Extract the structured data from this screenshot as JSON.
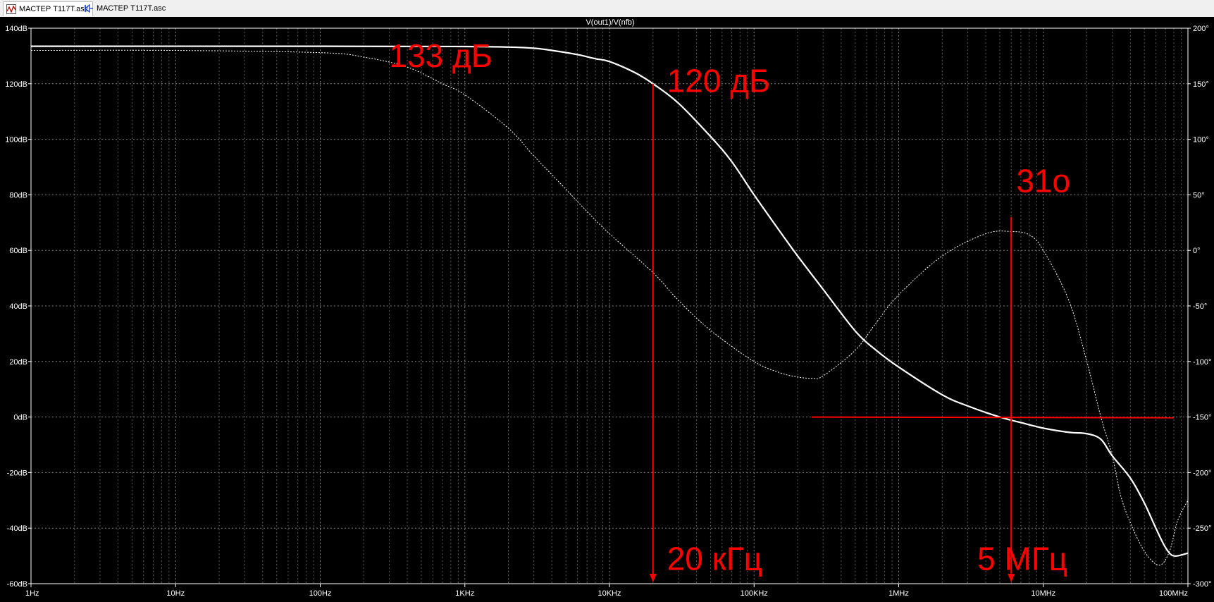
{
  "tabs": [
    {
      "label": "МАСТЕР Т117Т.asc",
      "icon": "waveform-plot-icon",
      "active": true
    },
    {
      "label": "МАСТЕР Т117Т.asc",
      "icon": "schematic-icon",
      "active": false
    }
  ],
  "chart_data": {
    "type": "line",
    "title": "V(out1)/V(nfb)",
    "x_scale": "log",
    "xlim_hz": [
      1,
      100000000
    ],
    "x_tick_labels": [
      "1Hz",
      "10Hz",
      "100Hz",
      "1KHz",
      "10KHz",
      "100KHz",
      "1MHz",
      "10MHz",
      "100MHz"
    ],
    "x_tick_values": [
      1,
      10,
      100,
      1000,
      10000,
      100000,
      1000000,
      10000000,
      100000000
    ],
    "y_left_ylim_db": [
      -60,
      140
    ],
    "y_left_tick_labels": [
      "140dB",
      "120dB",
      "100dB",
      "80dB",
      "60dB",
      "40dB",
      "20dB",
      "0dB",
      "-20dB",
      "-40dB",
      "-60dB"
    ],
    "y_left_tick_values": [
      140,
      120,
      100,
      80,
      60,
      40,
      20,
      0,
      -20,
      -40,
      -60
    ],
    "y_right_ylim_deg": [
      -300,
      200
    ],
    "y_right_tick_labels": [
      "200°",
      "150°",
      "100°",
      "50°",
      "0°",
      "-50°",
      "-100°",
      "-150°",
      "-200°",
      "-250°",
      "-300°"
    ],
    "y_right_tick_values": [
      200,
      150,
      100,
      50,
      0,
      -50,
      -100,
      -150,
      -200,
      -250,
      -300
    ],
    "grid": true,
    "background": "#000000",
    "trace_color": "#ffffff",
    "annotation_color": "#ff0000",
    "series": [
      {
        "axis": "left",
        "style": "solid",
        "points": [
          [
            1,
            133.5
          ],
          [
            100,
            133.5
          ],
          [
            1000,
            133.4
          ],
          [
            2000,
            133.2
          ],
          [
            3000,
            132.8
          ],
          [
            4000,
            132
          ],
          [
            6000,
            130.5
          ],
          [
            8000,
            129
          ],
          [
            10000,
            128
          ],
          [
            15000,
            124
          ],
          [
            20000,
            120
          ],
          [
            30000,
            113
          ],
          [
            50000,
            101
          ],
          [
            70000,
            92
          ],
          [
            100000,
            80
          ],
          [
            150000,
            67
          ],
          [
            200000,
            58
          ],
          [
            300000,
            46
          ],
          [
            500000,
            31
          ],
          [
            700000,
            24
          ],
          [
            1000000,
            18
          ],
          [
            2000000,
            8
          ],
          [
            3000000,
            4
          ],
          [
            5000000,
            0
          ],
          [
            7000000,
            -2
          ],
          [
            10000000,
            -4
          ],
          [
            15000000,
            -5.5
          ],
          [
            20000000,
            -6
          ],
          [
            25000000,
            -8
          ],
          [
            30000000,
            -14
          ],
          [
            40000000,
            -22
          ],
          [
            50000000,
            -31
          ],
          [
            60000000,
            -40
          ],
          [
            70000000,
            -47
          ],
          [
            80000000,
            -50
          ],
          [
            100000000,
            -49
          ]
        ]
      },
      {
        "axis": "right",
        "style": "dashed",
        "points": [
          [
            1,
            180
          ],
          [
            10,
            180
          ],
          [
            100,
            178
          ],
          [
            200,
            174
          ],
          [
            400,
            165
          ],
          [
            700,
            150
          ],
          [
            1000,
            140
          ],
          [
            2000,
            110
          ],
          [
            3000,
            85
          ],
          [
            5000,
            55
          ],
          [
            7000,
            35
          ],
          [
            10000,
            15
          ],
          [
            20000,
            -20
          ],
          [
            30000,
            -45
          ],
          [
            50000,
            -72
          ],
          [
            100000,
            -100
          ],
          [
            150000,
            -110
          ],
          [
            200000,
            -114
          ],
          [
            250000,
            -115
          ],
          [
            300000,
            -113
          ],
          [
            500000,
            -90
          ],
          [
            700000,
            -65
          ],
          [
            1000000,
            -40
          ],
          [
            2000000,
            -5
          ],
          [
            4000000,
            15
          ],
          [
            6000000,
            17
          ],
          [
            8000000,
            14
          ],
          [
            10000000,
            0
          ],
          [
            15000000,
            -45
          ],
          [
            20000000,
            -100
          ],
          [
            25000000,
            -150
          ],
          [
            30000000,
            -185
          ],
          [
            35000000,
            -225
          ],
          [
            45000000,
            -260
          ],
          [
            55000000,
            -278
          ],
          [
            65000000,
            -283
          ],
          [
            75000000,
            -270
          ],
          [
            85000000,
            -243
          ],
          [
            100000000,
            -225
          ]
        ]
      }
    ],
    "annotations": [
      {
        "text": "133 дБ",
        "x": 300,
        "y_db": 126
      },
      {
        "text": "120 дБ",
        "x": 25000,
        "y_db": 117
      },
      {
        "text": "31о",
        "x": 6500000,
        "y_db": 81
      },
      {
        "text": "20 кГц",
        "x": 25000,
        "y_db": -55
      },
      {
        "text": "5 МГц",
        "x": 3500000,
        "y_db": -55
      }
    ],
    "marker_lines": [
      {
        "kind": "vertical-arrow",
        "x": 20000,
        "y_from_db": 120,
        "y_to_db": -60
      },
      {
        "kind": "vertical-arrow",
        "x": 6000000,
        "y_from_db": 72,
        "y_to_db": -60
      },
      {
        "kind": "horizontal",
        "y_db": 0,
        "x_from": 250000,
        "x_to": 80000000
      }
    ]
  }
}
